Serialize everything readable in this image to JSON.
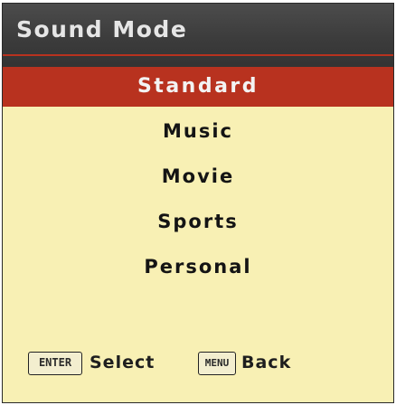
{
  "title": "Sound Mode",
  "options": [
    {
      "label": "Standard",
      "selected": true
    },
    {
      "label": "Music",
      "selected": false
    },
    {
      "label": "Movie",
      "selected": false
    },
    {
      "label": "Sports",
      "selected": false
    },
    {
      "label": "Personal",
      "selected": false
    }
  ],
  "footer": {
    "enter_key": "ENTER",
    "select_label": "Select",
    "menu_key": "MENU",
    "back_label": "Back"
  },
  "colors": {
    "panel_background": "#f8f0b4",
    "title_background": "#3c3c3c",
    "highlight": "#b8321f",
    "title_text": "#e6e6e6"
  }
}
